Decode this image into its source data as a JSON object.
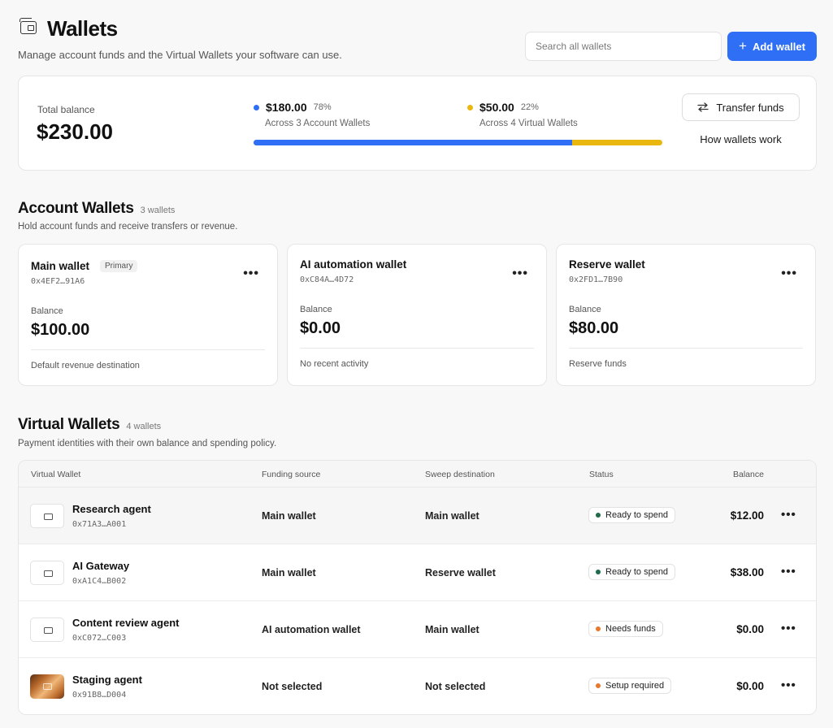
{
  "header": {
    "title": "Wallets",
    "subtitle": "Manage account funds and the Virtual Wallets your software can use.",
    "search_placeholder": "Search all wallets",
    "add_button": "Add wallet",
    "add_icon": "plus-icon"
  },
  "summary": {
    "total_label": "Total balance",
    "total_value": "$230.00",
    "segments": [
      {
        "amount": "$180.00",
        "pct": "78%",
        "sub": "Across 3 Account Wallets",
        "color": "#2f6ff5",
        "share": 0.78
      },
      {
        "amount": "$50.00",
        "pct": "22%",
        "sub": "Across 4 Virtual Wallets",
        "color": "#e9b70e",
        "share": 0.22
      }
    ],
    "transfer_button": "Transfer funds",
    "transfer_icon": "swap-arrows-icon",
    "how_link": "How wallets work"
  },
  "account_section": {
    "title": "Account Wallets",
    "count": "3 wallets",
    "desc": "Hold account funds and receive transfers or revenue.",
    "wallets": [
      {
        "name": "Main wallet",
        "badge": "Primary",
        "addr": "0x4EF2…91A6",
        "balance_label": "Balance",
        "balance": "$100.00",
        "note": "Default revenue destination"
      },
      {
        "name": "AI automation wallet",
        "addr": "0xC84A…4D72",
        "balance_label": "Balance",
        "balance": "$0.00",
        "note": "No recent activity"
      },
      {
        "name": "Reserve wallet",
        "addr": "0x2FD1…7B90",
        "balance_label": "Balance",
        "balance": "$80.00",
        "note": "Reserve funds"
      }
    ]
  },
  "virtual_section": {
    "title": "Virtual Wallets",
    "count": "4 wallets",
    "desc": "Payment identities with their own balance and spending policy.",
    "columns": [
      "Virtual Wallet",
      "Funding source",
      "Sweep destination",
      "Status",
      "Balance"
    ],
    "rows": [
      {
        "name": "Research agent",
        "addr": "0x71A3…A001",
        "funding": "Main wallet",
        "sweep": "Main wallet",
        "status": "Ready to spend",
        "status_color": "#1f6b4a",
        "balance": "$12.00",
        "icon": "card-icon"
      },
      {
        "name": "AI Gateway",
        "addr": "0xA1C4…B002",
        "funding": "Main wallet",
        "sweep": "Reserve wallet",
        "status": "Ready to spend",
        "status_color": "#1f6b4a",
        "balance": "$38.00",
        "icon": "card-icon"
      },
      {
        "name": "Content review agent",
        "addr": "0xC072…C003",
        "funding": "AI automation wallet",
        "sweep": "Main wallet",
        "status": "Needs funds",
        "status_color": "#e9782a",
        "balance": "$0.00",
        "icon": "card-icon"
      },
      {
        "name": "Staging agent",
        "addr": "0x91B8…D004",
        "funding": "Not selected",
        "sweep": "Not selected",
        "status": "Setup required",
        "status_color": "#e9782a",
        "balance": "$0.00",
        "icon": "gradient-card-icon"
      }
    ]
  }
}
